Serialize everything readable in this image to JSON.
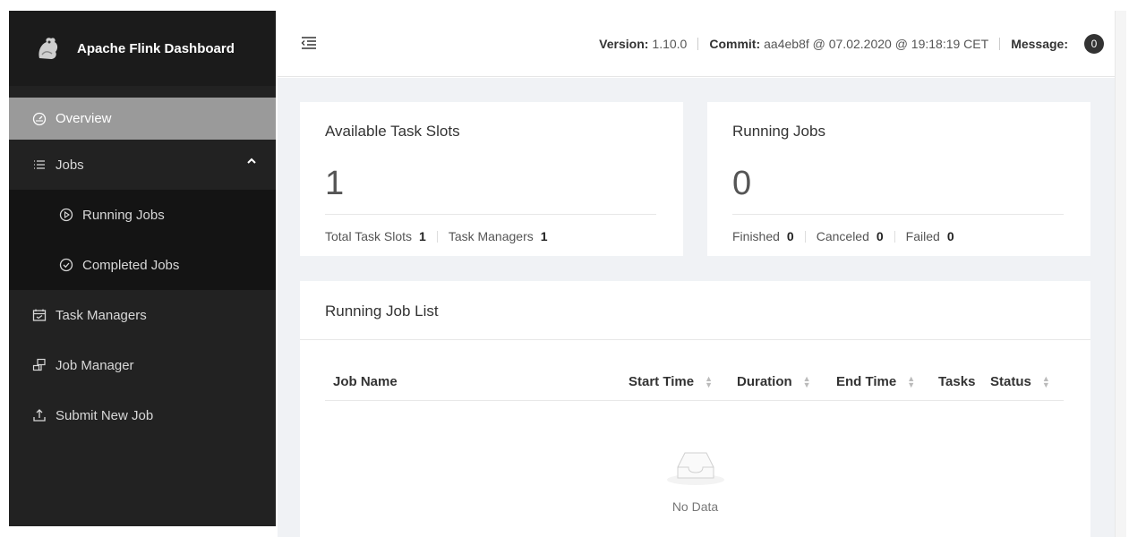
{
  "app": {
    "title": "Apache Flink Dashboard"
  },
  "sidebar": {
    "items": [
      {
        "label": "Overview",
        "icon": "dashboard-icon"
      },
      {
        "label": "Jobs",
        "icon": "list-icon"
      },
      {
        "label": "Running Jobs",
        "icon": "play-circle-icon"
      },
      {
        "label": "Completed Jobs",
        "icon": "check-circle-icon"
      },
      {
        "label": "Task Managers",
        "icon": "schedule-icon"
      },
      {
        "label": "Job Manager",
        "icon": "cluster-icon"
      },
      {
        "label": "Submit New Job",
        "icon": "upload-icon"
      }
    ]
  },
  "header": {
    "version_label": "Version:",
    "version": "1.10.0",
    "commit_label": "Commit:",
    "commit": "aa4eb8f @ 07.02.2020 @ 19:18:19 CET",
    "message_label": "Message:",
    "message_count": "0"
  },
  "slots": {
    "title": "Available Task Slots",
    "value": "1",
    "total_label": "Total Task Slots",
    "total": "1",
    "managers_label": "Task Managers",
    "managers": "1"
  },
  "running": {
    "title": "Running Jobs",
    "value": "0",
    "finished_label": "Finished",
    "finished": "0",
    "canceled_label": "Canceled",
    "canceled": "0",
    "failed_label": "Failed",
    "failed": "0"
  },
  "joblist": {
    "title": "Running Job List",
    "columns": [
      "Job Name",
      "Start Time",
      "Duration",
      "End Time",
      "Tasks",
      "Status"
    ],
    "empty_text": "No Data"
  },
  "colors": {
    "sidebar_bg": "#222222",
    "active_bg": "#9a9a9a",
    "submenu_bg": "#141414"
  }
}
